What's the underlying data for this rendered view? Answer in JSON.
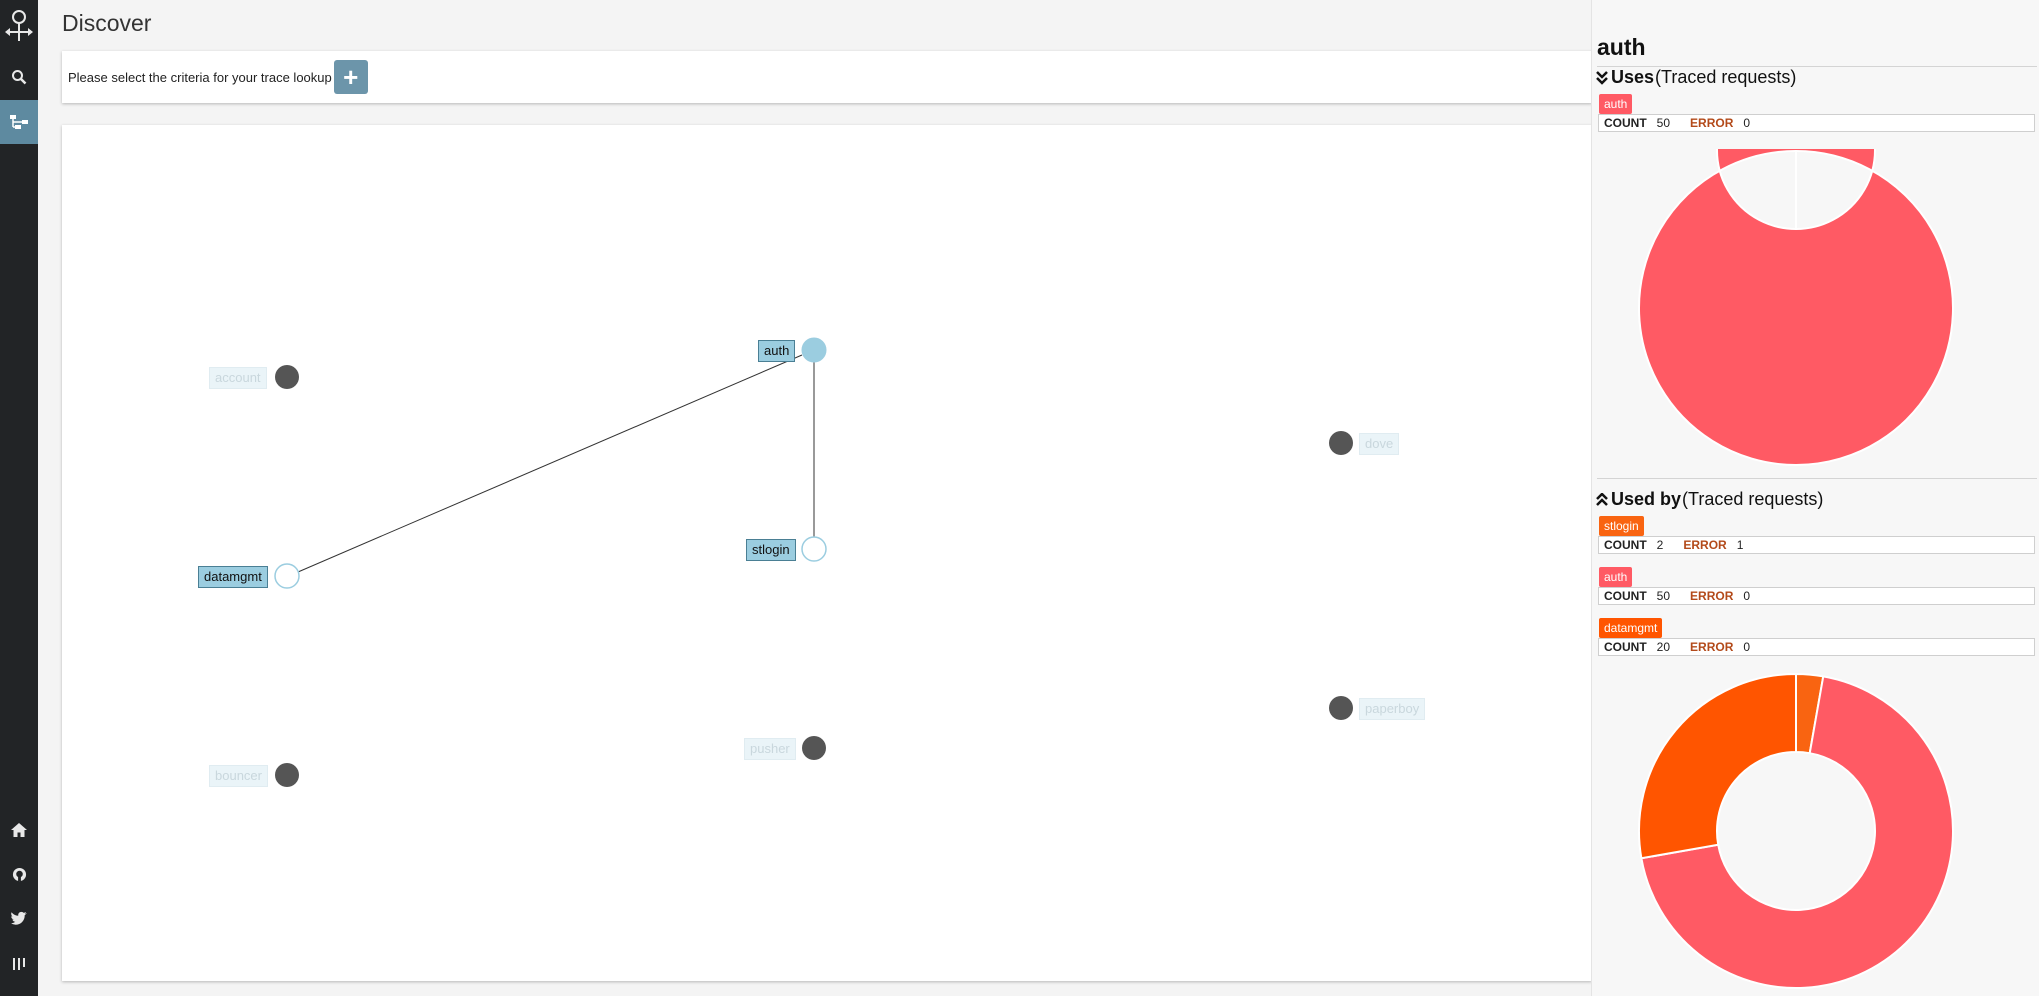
{
  "header": {
    "title": "Discover",
    "criteria_text": "Please select the criteria for your trace lookup",
    "add_label": "+"
  },
  "nav": [
    "logo-icon",
    "search-icon",
    "network-icon",
    "home-icon",
    "github-icon",
    "twitter-icon",
    "columns-icon"
  ],
  "graph": {
    "nodes": [
      {
        "id": "auth",
        "label": "auth",
        "state": "selected"
      },
      {
        "id": "account",
        "label": "account",
        "state": "inactive"
      },
      {
        "id": "dove",
        "label": "dove",
        "state": "inactive"
      },
      {
        "id": "stlogin",
        "label": "stlogin",
        "state": "linked"
      },
      {
        "id": "datamgmt",
        "label": "datamgmt",
        "state": "linked"
      },
      {
        "id": "paperboy",
        "label": "paperboy",
        "state": "inactive"
      },
      {
        "id": "pusher",
        "label": "pusher",
        "state": "inactive"
      },
      {
        "id": "bouncer",
        "label": "bouncer",
        "state": "inactive"
      }
    ],
    "edges": [
      {
        "from": "auth",
        "to": "datamgmt"
      },
      {
        "from": "auth",
        "to": "stlogin"
      }
    ]
  },
  "detail": {
    "title": "auth",
    "uses": {
      "heading": "Uses",
      "subheading": "(Traced requests)",
      "items": [
        {
          "name": "auth",
          "color": "#ff5a64",
          "count_label": "COUNT",
          "count": "50",
          "error_label": "ERROR",
          "error": "0"
        }
      ]
    },
    "used_by": {
      "heading": "Used by",
      "subheading": "(Traced requests)",
      "items": [
        {
          "name": "stlogin",
          "color": "#f96411",
          "count_label": "COUNT",
          "count": "2",
          "error_label": "ERROR",
          "error": "1"
        },
        {
          "name": "auth",
          "color": "#ff5a64",
          "count_label": "COUNT",
          "count": "50",
          "error_label": "ERROR",
          "error": "0"
        },
        {
          "name": "datamgmt",
          "color": "#ff5500",
          "count_label": "COUNT",
          "count": "20",
          "error_label": "ERROR",
          "error": "0"
        }
      ]
    },
    "colors": {
      "auth": "#ff5a64",
      "stlogin": "#f96411",
      "datamgmt": "#ff5500",
      "accent": "#6c95aa",
      "selected_node": "#9bcde0"
    }
  }
}
